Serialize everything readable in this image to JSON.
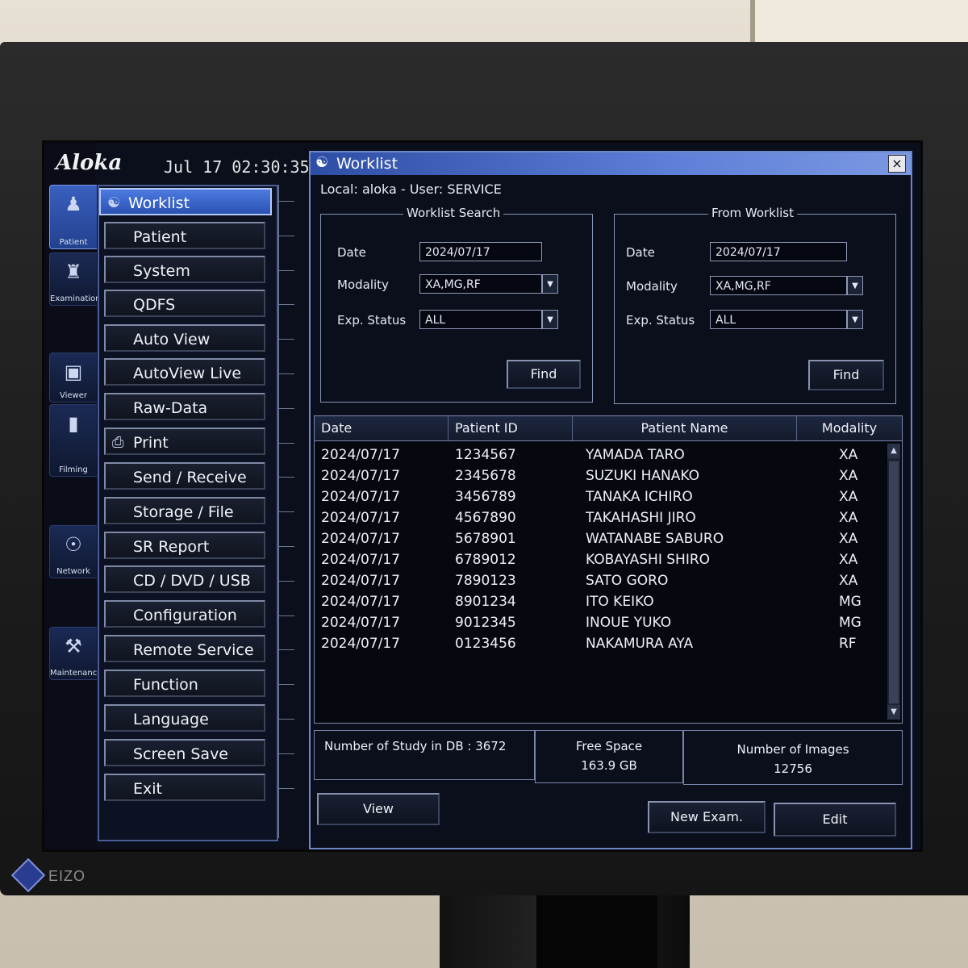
{
  "brand": {
    "logo": "Aloka",
    "clock": "Jul  17  02:30:35",
    "monitor": "EIZO"
  },
  "side_tabs": [
    {
      "label": "Patient",
      "icon": "patient-icon"
    },
    {
      "label": "Examination",
      "icon": "examination-icon"
    },
    {
      "label": "Viewer",
      "icon": "viewer-icon"
    },
    {
      "label": "Filming",
      "icon": "filming-icon"
    },
    {
      "label": "Network",
      "icon": "network-icon"
    },
    {
      "label": "Maintenance",
      "icon": "wrench-icon"
    }
  ],
  "menu": [
    {
      "label": "Worklist",
      "selected": true
    },
    {
      "label": "Patient"
    },
    {
      "label": "System"
    },
    {
      "label": "QDFS"
    },
    {
      "label": "Auto View"
    },
    {
      "label": "AutoView Live"
    },
    {
      "label": "Raw-Data"
    },
    {
      "label": "Print"
    },
    {
      "label": "Send / Receive"
    },
    {
      "label": "Storage / File"
    },
    {
      "label": "SR Report"
    },
    {
      "label": "CD / DVD / USB"
    },
    {
      "label": "Configuration"
    },
    {
      "label": "Remote Service"
    },
    {
      "label": "Function"
    },
    {
      "label": "Language"
    },
    {
      "label": "Screen Save"
    },
    {
      "label": "Exit"
    }
  ],
  "window": {
    "title": "Worklist",
    "close": "×",
    "status": "Local:  aloka  -  User: SERVICE"
  },
  "search": {
    "title": "Worklist Search",
    "date_label": "Date",
    "date": "2024/07/17",
    "modality_label": "Modality",
    "modality": "XA,MG,RF",
    "exp_label": "Exp. Status",
    "exp": "ALL",
    "find": "Find"
  },
  "from_worklist": {
    "title": "From Worklist",
    "date_label": "Date",
    "date": "2024/07/17",
    "modality_label": "Modality",
    "modality": "XA,MG,RF",
    "exp_label": "Exp. Status",
    "exp": "ALL",
    "find": "Find"
  },
  "table": {
    "headers": [
      "Date",
      "Patient ID",
      "Patient Name",
      "Modality"
    ],
    "rows": [
      [
        "2024/07/17",
        "1234567",
        "YAMADA TARO",
        "XA"
      ],
      [
        "2024/07/17",
        "2345678",
        "SUZUKI HANAKO",
        "XA"
      ],
      [
        "2024/07/17",
        "3456789",
        "TANAKA ICHIRO",
        "XA"
      ],
      [
        "2024/07/17",
        "4567890",
        "TAKAHASHI JIRO",
        "XA"
      ],
      [
        "2024/07/17",
        "5678901",
        "WATANABE SABURO",
        "XA"
      ],
      [
        "2024/07/17",
        "6789012",
        "KOBAYASHI SHIRO",
        "XA"
      ],
      [
        "2024/07/17",
        "7890123",
        "SATO GORO",
        "XA"
      ],
      [
        "2024/07/17",
        "8901234",
        "ITO KEIKO",
        "MG"
      ],
      [
        "2024/07/17",
        "9012345",
        "INOUE YUKO",
        "MG"
      ],
      [
        "2024/07/17",
        "0123456",
        "NAKAMURA AYA",
        "RF"
      ]
    ]
  },
  "info": {
    "studies": "Number of Study in DB : 3672",
    "free_label": "Free Space",
    "free_value": "163.9 GB",
    "images_label": "Number of Images",
    "images_value": "12756"
  },
  "actions": {
    "view": "View",
    "new_exam": "New Exam.",
    "edit": "Edit"
  }
}
